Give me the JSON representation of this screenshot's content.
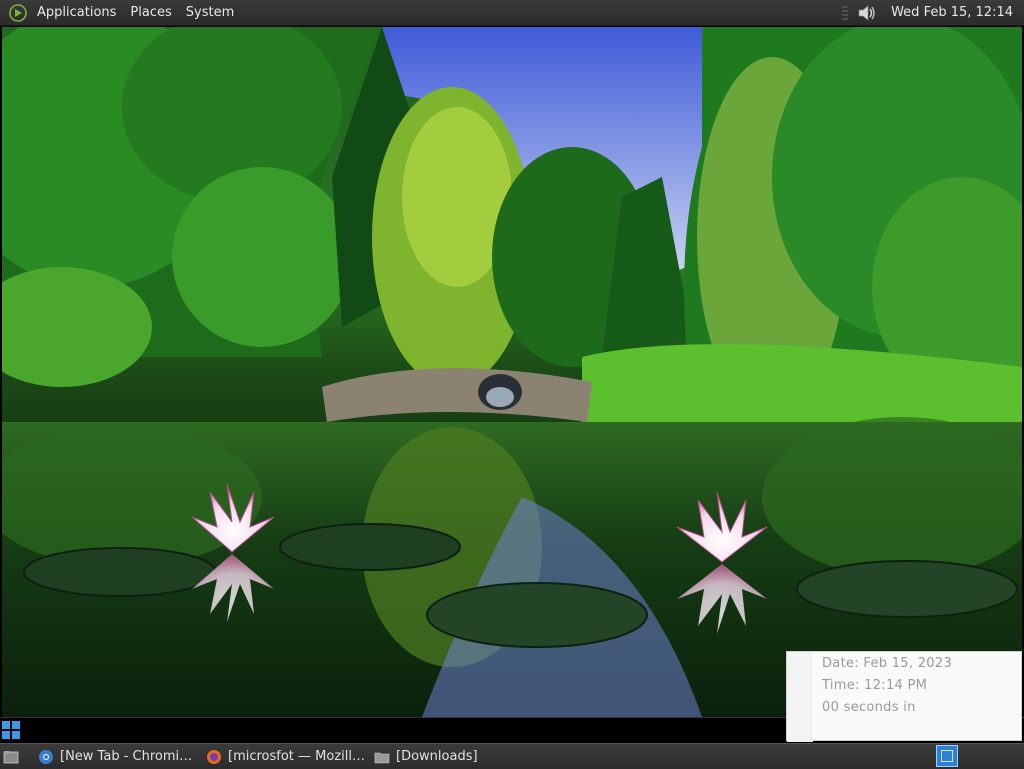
{
  "top_panel": {
    "menus": [
      "Applications",
      "Places",
      "System"
    ],
    "clock": "Wed Feb 15, 12:14"
  },
  "wallpaper": {
    "description_icon": "lotus-pond-wallpaper"
  },
  "time_popup": {
    "date_line": "Date: Feb 15, 2023",
    "time_line": "Time: 12:14 PM",
    "seconds_line": "00 seconds in"
  },
  "taskbar": {
    "tasks": [
      {
        "label": "[New Tab - Chromi…",
        "icon": "chromium-icon"
      },
      {
        "label": "[microsfot — Mozill…",
        "icon": "firefox-icon"
      },
      {
        "label": "[Downloads]",
        "icon": "folder-icon"
      }
    ]
  },
  "colors": {
    "panel_bg": "#2f2f2f",
    "panel_text": "#e8e8e8",
    "accent_blue": "#2e7fd6"
  }
}
